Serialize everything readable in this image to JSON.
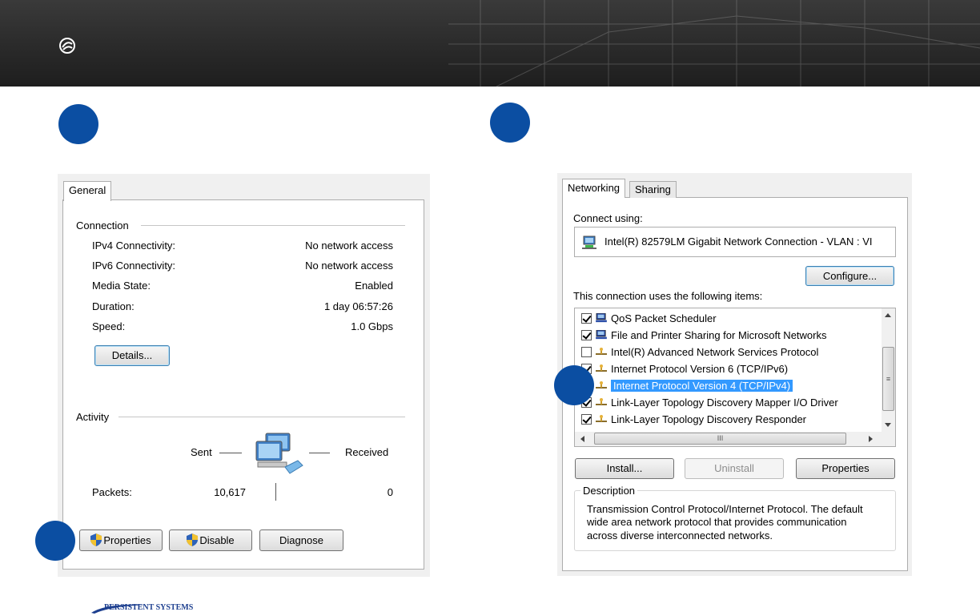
{
  "colors": {
    "accent": "#0b4ea2",
    "selection": "#3399ff",
    "banner": "#2a2a2a"
  },
  "brand": {
    "footer_logo_text": "PERSISTENT SYSTEMS"
  },
  "status_dialog": {
    "tab": "General",
    "connection": {
      "label": "Connection",
      "rows": [
        {
          "label": "IPv4 Connectivity:",
          "value": "No network access"
        },
        {
          "label": "IPv6 Connectivity:",
          "value": "No network access"
        },
        {
          "label": "Media State:",
          "value": "Enabled"
        },
        {
          "label": "Duration:",
          "value": "1 day 06:57:26"
        },
        {
          "label": "Speed:",
          "value": "1.0 Gbps"
        }
      ],
      "details_button": "Details..."
    },
    "activity": {
      "label": "Activity",
      "sent_label": "Sent",
      "received_label": "Received",
      "packets_label": "Packets:",
      "packets_sent": "10,617",
      "packets_received": "0"
    },
    "buttons": {
      "properties": "Properties",
      "disable": "Disable",
      "diagnose": "Diagnose"
    }
  },
  "properties_dialog": {
    "tabs": [
      "Networking",
      "Sharing"
    ],
    "connect_using_label": "Connect using:",
    "adapter_name": "Intel(R) 82579LM Gigabit Network Connection - VLAN : VI",
    "configure_button": "Configure...",
    "items_label": "This connection uses the following items:",
    "items": [
      {
        "label": "QoS Packet Scheduler",
        "checked": true,
        "icon": "network-client-icon"
      },
      {
        "label": "File and Printer Sharing for Microsoft Networks",
        "checked": true,
        "icon": "network-client-icon"
      },
      {
        "label": "Intel(R) Advanced Network Services Protocol",
        "checked": false,
        "icon": "protocol-icon"
      },
      {
        "label": "Internet Protocol Version 6 (TCP/IPv6)",
        "checked": true,
        "icon": "protocol-icon"
      },
      {
        "label": "Internet Protocol Version 4 (TCP/IPv4)",
        "checked": true,
        "icon": "protocol-icon",
        "selected": true
      },
      {
        "label": "Link-Layer Topology Discovery Mapper I/O Driver",
        "checked": true,
        "icon": "protocol-icon"
      },
      {
        "label": "Link-Layer Topology Discovery Responder",
        "checked": true,
        "icon": "protocol-icon"
      }
    ],
    "scroll_grip": "≡",
    "hscroll_grip": "III",
    "buttons": {
      "install": "Install...",
      "uninstall": "Uninstall",
      "properties": "Properties"
    },
    "description_label": "Description",
    "description_lines": [
      "Transmission Control Protocol/Internet Protocol. The default",
      "wide area network protocol that provides communication",
      "across diverse interconnected networks."
    ]
  }
}
